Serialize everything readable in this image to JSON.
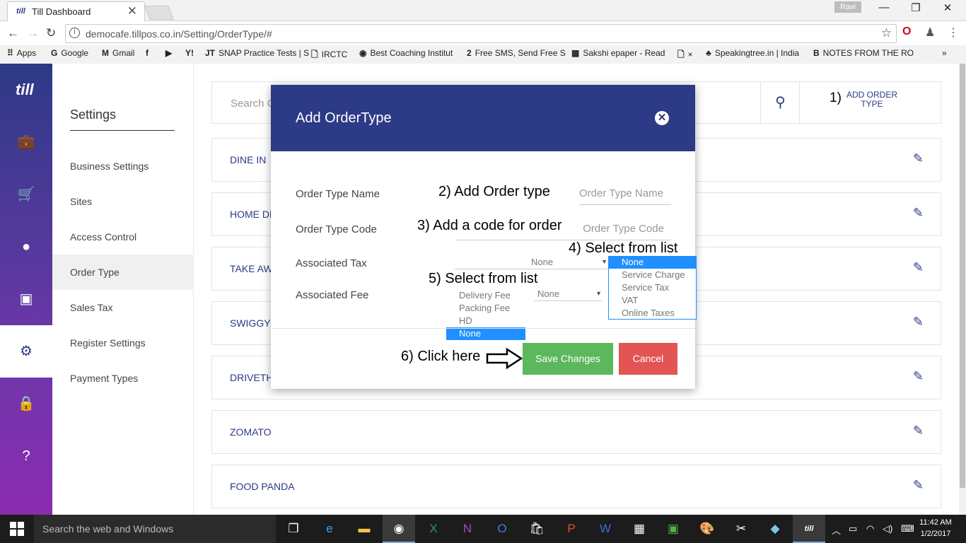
{
  "browser": {
    "tab_title": "Till Dashboard",
    "tab_favicon": "till",
    "tab_close": "✕",
    "user": "Ravi",
    "url": "democafe.tillpos.co.in/Setting/OrderType/#",
    "bookmarks": [
      {
        "icon": "apps-icon",
        "glyph": "⠿",
        "label": "Apps"
      },
      {
        "icon": "google-icon",
        "glyph": "G",
        "label": "Google"
      },
      {
        "icon": "gmail-icon",
        "glyph": "M",
        "label": "Gmail"
      },
      {
        "icon": "facebook-icon",
        "glyph": "f",
        "label": ""
      },
      {
        "icon": "youtube-icon",
        "glyph": "▶",
        "label": ""
      },
      {
        "icon": "yahoo-icon",
        "glyph": "Y!",
        "label": ""
      },
      {
        "icon": "jt-icon",
        "glyph": "JT",
        "label": "SNAP Practice Tests | S"
      },
      {
        "icon": "page-icon",
        "glyph": "🗋",
        "label": "IRCTC"
      },
      {
        "icon": "coaching-icon",
        "glyph": "◉",
        "label": "Best Coaching Institut"
      },
      {
        "icon": "sms-icon",
        "glyph": "2",
        "label": "Free SMS, Send Free S"
      },
      {
        "icon": "epaper-icon",
        "glyph": "▦",
        "label": "Sakshi epaper - Read"
      },
      {
        "icon": "page-icon",
        "glyph": "🗋",
        "label": "×"
      },
      {
        "icon": "tree-icon",
        "glyph": "♣",
        "label": "Speakingtree.in | India"
      },
      {
        "icon": "blogger-icon",
        "glyph": "B",
        "label": "NOTES FROM THE RO"
      }
    ],
    "more": "»"
  },
  "rail": {
    "logo": "till",
    "icons": [
      "briefcase-icon",
      "cart-icon",
      "user-icon",
      "chart-icon",
      "gear-icon",
      "lock-icon",
      "help-icon"
    ]
  },
  "settings_nav": {
    "heading": "Settings",
    "items": [
      "Business Settings",
      "Sites",
      "Access Control",
      "Order Type",
      "Sales Tax",
      "Register Settings",
      "Payment Types"
    ],
    "active_index": 3
  },
  "main": {
    "search_placeholder": "Search O",
    "add_button": {
      "step": "1)",
      "label": "ADD ORDER TYPE"
    },
    "order_types": [
      "DINE IN",
      "HOME DE",
      "TAKE AW",
      "SWIGGY",
      "DRIVETH",
      "ZOMATO",
      "FOOD PANDA"
    ]
  },
  "modal": {
    "title": "Add OrderType",
    "close": "✕",
    "fields": {
      "name_label": "Order Type Name",
      "name_placeholder": "Order Type Name",
      "code_label": "Order Type Code",
      "code_placeholder": "Order Type Code",
      "tax_label": "Associated Tax",
      "tax_value": "None",
      "fee_label": "Associated Fee",
      "fee_value": "None"
    },
    "tax_options": [
      "None",
      "Service Charge",
      "Service Tax",
      "VAT",
      "Online Taxes"
    ],
    "tax_selected": "None",
    "fee_options": [
      "Delivery Fee",
      "Packing Fee",
      "HD",
      "None"
    ],
    "fee_selected": "None",
    "save_label": "Save Changes",
    "cancel_label": "Cancel"
  },
  "annotations": {
    "a2": "2) Add Order type",
    "a3": "3) Add a code for order",
    "a4": "4) Select from list",
    "a5": "5) Select from list",
    "a6": "6) Click here"
  },
  "taskbar": {
    "search": "Search the web and Windows",
    "time": "11:42 AM",
    "date": "1/2/2017"
  }
}
